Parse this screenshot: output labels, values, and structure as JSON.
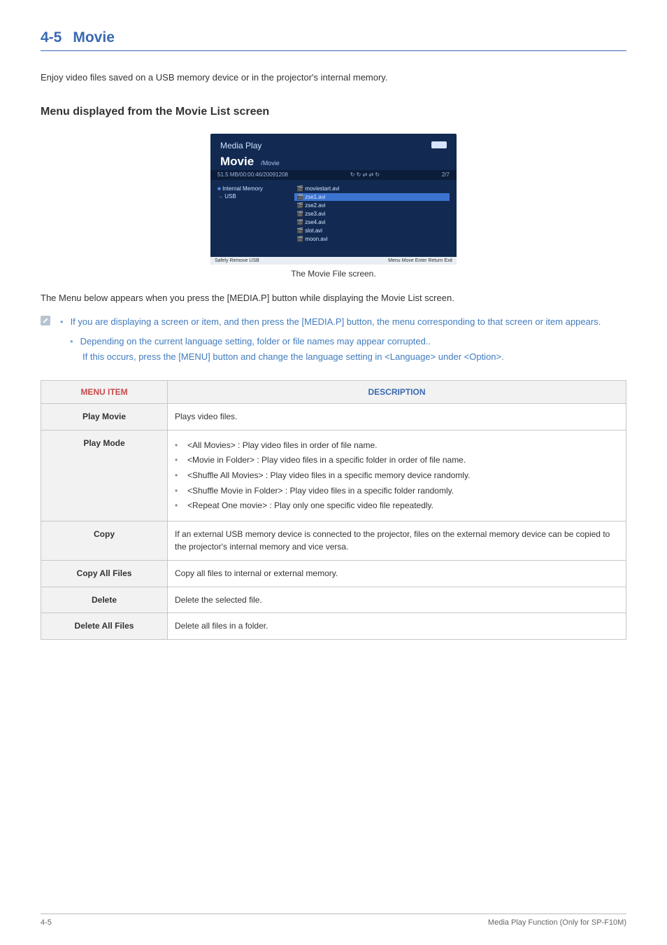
{
  "section": {
    "num": "4-5",
    "title": "Movie"
  },
  "intro": "Enjoy video files saved on a USB memory device or in the projector's internal memory.",
  "subhead": "Menu displayed from the Movie List screen",
  "shot": {
    "mediaplay": "Media Play",
    "movie": "Movie",
    "path": "/Movie",
    "barLeft": "51.5 MB/00:00:46/20091208",
    "barRight": "2/7",
    "leftItems": [
      "Internal Memory",
      "USB"
    ],
    "files": [
      "moviestart.avi",
      "zse1.avi",
      "zse2.avi",
      "zse3.avi",
      "zse4.avi",
      "slot.avi",
      "moon.avi"
    ],
    "footL": "Safely Remove USB",
    "footR": "Menu   Move   Enter   Return   Exit"
  },
  "caption": "The Movie File screen.",
  "afterShot": "The Menu below appears when you press the [MEDIA.P] button while displaying the Movie List screen.",
  "note1": "If you are displaying a screen or item, and then press the [MEDIA.P] button, the menu corresponding to that screen or item appears.",
  "note2a": "Depending on the current language setting, folder or file names may appear corrupted..",
  "note2b": "If this occurs, press the [MENU] button and change the language setting in <Language> under <Option>.",
  "tbl": {
    "h1": "MENU ITEM",
    "h2": "DESCRIPTION",
    "rows": [
      {
        "label": "Play Movie",
        "desc": "Plays video files."
      },
      {
        "label": "Play Mode",
        "opts": [
          "<All Movies> : Play video files in order of file name.",
          "<Movie in Folder> : Play video files in a specific folder in order of file name.",
          "<Shuffle All Movies> : Play video files in a specific memory device randomly.",
          "<Shuffle Movie in Folder> : Play video files in a specific folder randomly.",
          "<Repeat One movie> : Play only one specific video file repeatedly."
        ]
      },
      {
        "label": "Copy",
        "desc": "If an external USB memory device is connected to the projector, files on the external memory device can be copied to the projector's internal memory and vice versa."
      },
      {
        "label": "Copy All Files",
        "desc": "Copy all files to internal or external memory."
      },
      {
        "label": "Delete",
        "desc": "Delete the selected file."
      },
      {
        "label": "Delete All Files",
        "desc": "Delete all files in a folder."
      }
    ]
  },
  "footer": {
    "left": "4-5",
    "right": "Media Play Function (Only for SP-F10M)"
  }
}
